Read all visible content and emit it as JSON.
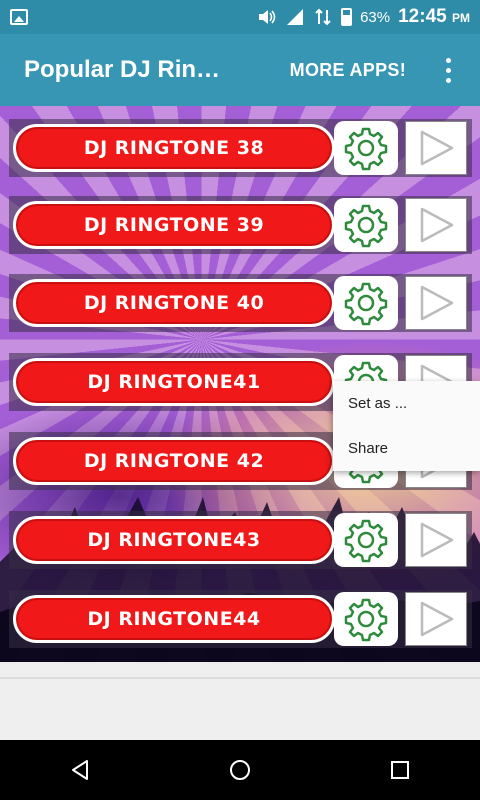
{
  "status_bar": {
    "battery_percent": "63%",
    "time": "12:45",
    "ampm": "PM"
  },
  "app_bar": {
    "title": "Popular DJ Rin…",
    "more_apps": "MORE APPS!"
  },
  "ringtones": [
    {
      "label": "DJ RINGTONE 38"
    },
    {
      "label": "DJ RINGTONE 39"
    },
    {
      "label": "DJ RINGTONE 40"
    },
    {
      "label": "DJ RINGTONE41"
    },
    {
      "label": "DJ RINGTONE 42"
    },
    {
      "label": "DJ RINGTONE43"
    },
    {
      "label": "DJ RINGTONE44"
    }
  ],
  "popup_menu": {
    "items": [
      {
        "label": "Set as ..."
      },
      {
        "label": "Share"
      }
    ]
  },
  "colors": {
    "app_bar": "#3696b3",
    "status_bar": "#2f8ca8",
    "ringtone_button": "#f01818",
    "gear_icon": "#2e8b3c"
  },
  "icons": {
    "status": [
      "image-icon",
      "volume-icon",
      "signal-icon",
      "data-transfer-icon",
      "battery-icon"
    ],
    "row": [
      "gear-icon",
      "play-icon"
    ],
    "nav": [
      "back-icon",
      "home-icon",
      "recents-icon"
    ]
  }
}
